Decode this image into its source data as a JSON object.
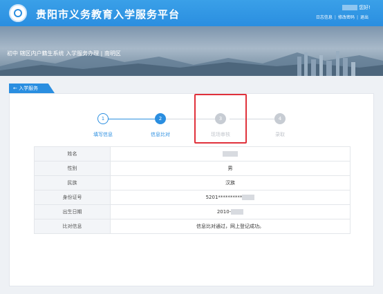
{
  "header": {
    "title": "贵阳市义务教育入学服务平台",
    "greeting": "您好!",
    "links": [
      "日志信息",
      "修改密码",
      "退出"
    ]
  },
  "banner": {
    "breadcrumb": "初中 辖区内户籍生系统 入学服务办理 | 南明区"
  },
  "back_tab": "← 入学服务",
  "steps": [
    {
      "num": "1",
      "label": "填写信息",
      "state": "done"
    },
    {
      "num": "2",
      "label": "信息比对",
      "state": "active"
    },
    {
      "num": "3",
      "label": "现场审核",
      "state": "todo"
    },
    {
      "num": "4",
      "label": "录取",
      "state": "todo"
    }
  ],
  "info": {
    "rows": [
      {
        "key": "姓名",
        "value": ""
      },
      {
        "key": "性别",
        "value": "男"
      },
      {
        "key": "民族",
        "value": "汉族"
      },
      {
        "key": "身份证号",
        "value": "5201**********"
      },
      {
        "key": "出生日期",
        "value": "2010-"
      },
      {
        "key": "比对信息",
        "value": "信息比对通过，网上登记成功。"
      }
    ]
  },
  "colors": {
    "primary": "#2a8ee0",
    "highlight": "#e0303a",
    "success_text": "#f0a020",
    "inactive": "#c7ccd3"
  }
}
